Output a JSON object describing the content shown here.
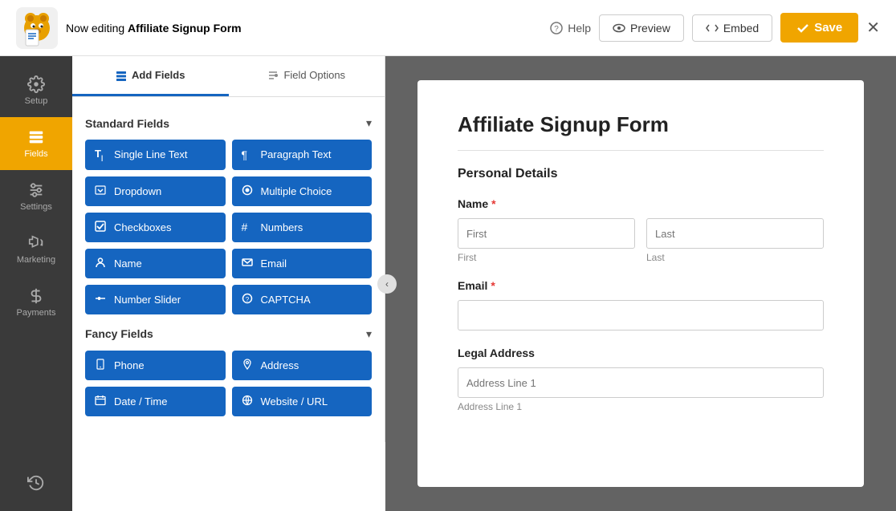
{
  "topbar": {
    "editing_prefix": "Now editing",
    "form_name": "Affiliate Signup Form",
    "help_label": "Help",
    "preview_label": "Preview",
    "embed_label": "Embed",
    "save_label": "Save"
  },
  "sidebar": {
    "items": [
      {
        "id": "setup",
        "label": "Setup",
        "icon": "gear"
      },
      {
        "id": "fields",
        "label": "Fields",
        "icon": "fields",
        "active": true
      },
      {
        "id": "settings",
        "label": "Settings",
        "icon": "sliders"
      },
      {
        "id": "marketing",
        "label": "Marketing",
        "icon": "megaphone"
      },
      {
        "id": "payments",
        "label": "Payments",
        "icon": "dollar"
      }
    ],
    "bottom_icon": "history"
  },
  "panel": {
    "tab_add_fields": "Add Fields",
    "tab_field_options": "Field Options",
    "standard_fields_title": "Standard Fields",
    "fancy_fields_title": "Fancy Fields",
    "standard_fields": [
      {
        "label": "Single Line Text",
        "icon": "T"
      },
      {
        "label": "Paragraph Text",
        "icon": "¶"
      },
      {
        "label": "Dropdown",
        "icon": "☰"
      },
      {
        "label": "Multiple Choice",
        "icon": "◎"
      },
      {
        "label": "Checkboxes",
        "icon": "☑"
      },
      {
        "label": "Numbers",
        "icon": "#"
      },
      {
        "label": "Name",
        "icon": "👤"
      },
      {
        "label": "Email",
        "icon": "✉"
      },
      {
        "label": "Number Slider",
        "icon": "⊟"
      },
      {
        "label": "CAPTCHA",
        "icon": "?"
      }
    ],
    "fancy_fields": [
      {
        "label": "Phone",
        "icon": "📞"
      },
      {
        "label": "Address",
        "icon": "📍"
      },
      {
        "label": "Date / Time",
        "icon": "📅"
      },
      {
        "label": "Website / URL",
        "icon": "🔗"
      }
    ]
  },
  "form": {
    "title": "Affiliate Signup Form",
    "section_title": "Personal Details",
    "name_label": "Name",
    "name_first_placeholder": "First",
    "name_last_placeholder": "Last",
    "email_label": "Email",
    "legal_address_label": "Legal Address",
    "address_line1_placeholder": "Address Line 1"
  },
  "colors": {
    "sidebar_bg": "#3a3a3a",
    "active_tab": "#f0a500",
    "field_btn": "#1565c0",
    "save_btn": "#f0a500"
  }
}
